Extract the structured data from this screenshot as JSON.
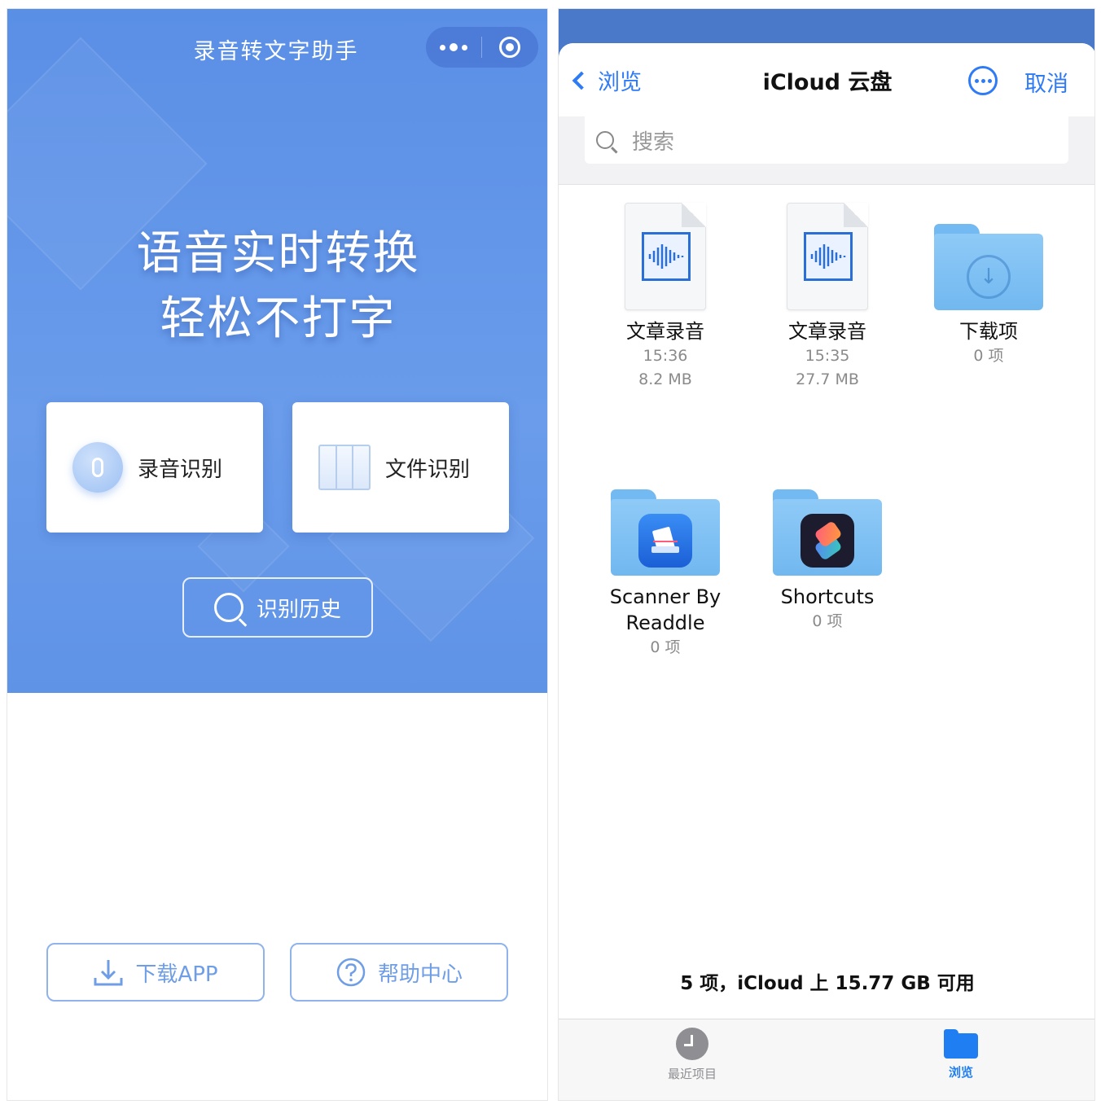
{
  "left": {
    "mini_program_title": "录音转文字助手",
    "headline_line1": "语音实时转换",
    "headline_line2": "轻松不打字",
    "cards": [
      {
        "label": "录音识别",
        "icon": "microphone-icon"
      },
      {
        "label": "文件识别",
        "icon": "file-columns-icon"
      }
    ],
    "history_button": "识别历史",
    "download_button": "下载APP",
    "help_button": "帮助中心",
    "colors": {
      "accent": "#5a8fe6",
      "button_text": "#6f9ee6"
    }
  },
  "right": {
    "nav": {
      "back_label": "浏览",
      "title": "iCloud 云盘",
      "cancel_label": "取消"
    },
    "search": {
      "placeholder": "搜索"
    },
    "items": [
      {
        "name": "文章录音",
        "time": "15:36",
        "size": "8.2 MB",
        "type": "audio-file"
      },
      {
        "name": "文章录音",
        "time": "15:35",
        "size": "27.7 MB",
        "type": "audio-file"
      },
      {
        "name": "下载项",
        "count": "0 项",
        "type": "folder-downloads"
      },
      {
        "name_line1": "Scanner By",
        "name_line2": "Readdle",
        "count": "0 项",
        "type": "folder-app-scanner"
      },
      {
        "name": "Shortcuts",
        "count": "0 项",
        "type": "folder-app-shortcuts"
      }
    ],
    "storage_text": "5 项，iCloud 上 15.77 GB 可用",
    "tabs": [
      {
        "label": "最近项目",
        "icon": "clock-icon",
        "active": false
      },
      {
        "label": "浏览",
        "icon": "folder-icon",
        "active": true
      }
    ],
    "colors": {
      "accent": "#2f7bf6",
      "tab_inactive": "#8e8e93",
      "folder": "#74baf2"
    }
  }
}
